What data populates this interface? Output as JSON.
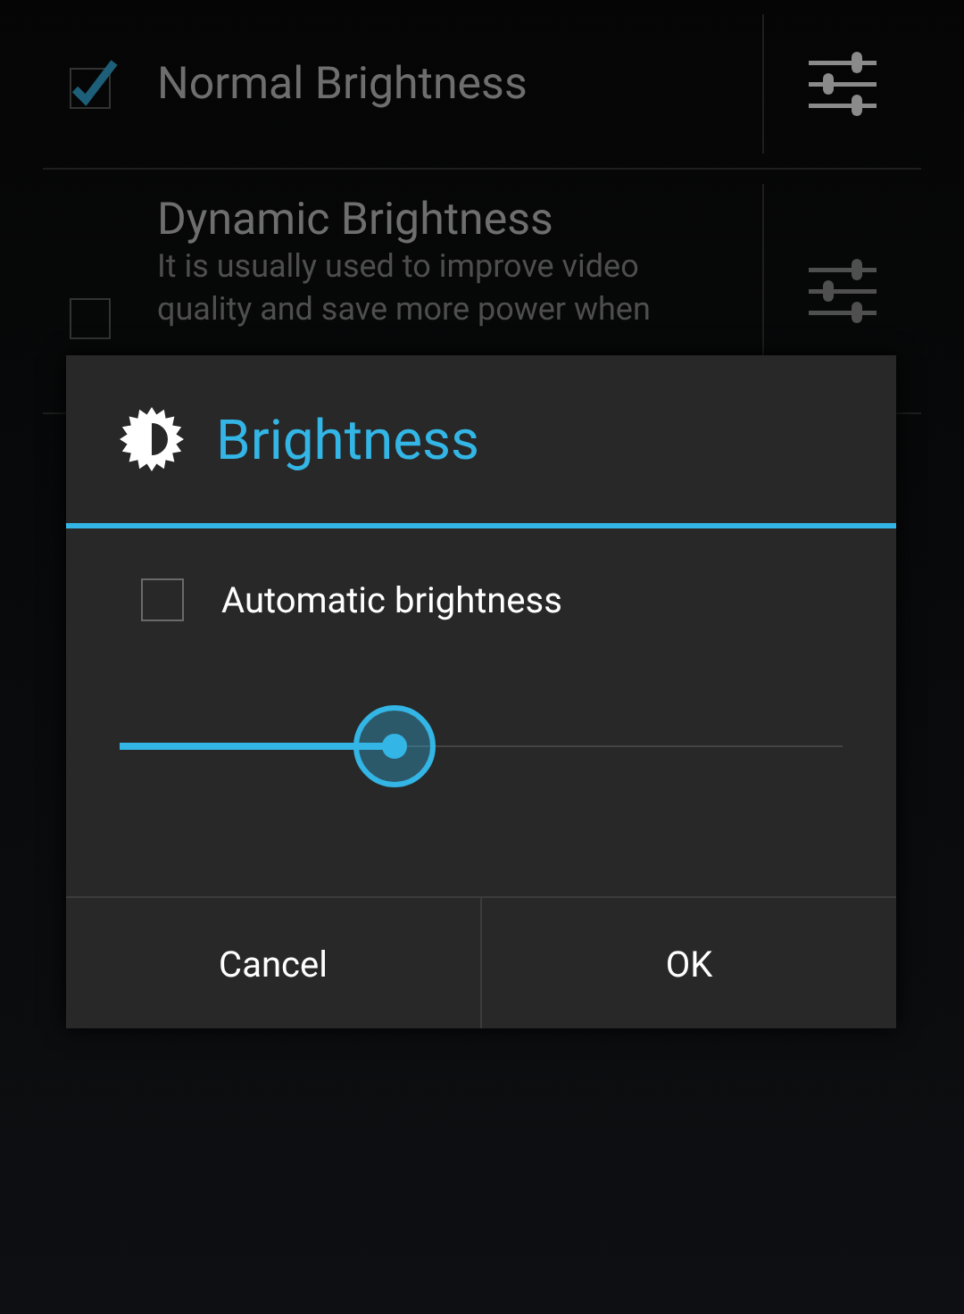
{
  "list": [
    {
      "title": "Normal Brightness",
      "checked": true
    },
    {
      "title": "Dynamic Brightness",
      "description": "It is usually used to improve video quality and save more power when",
      "checked": false
    }
  ],
  "dialog": {
    "title": "Brightness",
    "auto": {
      "label": "Automatic brightness",
      "checked": false
    },
    "slider": {
      "level": 0.38
    },
    "buttons": [
      "Cancel",
      "OK"
    ]
  }
}
